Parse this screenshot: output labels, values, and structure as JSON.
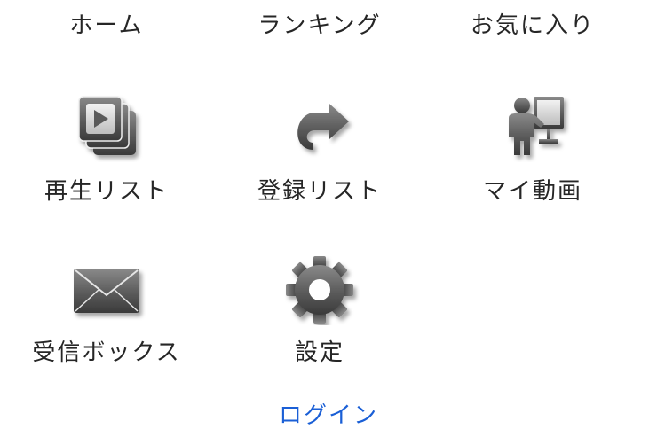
{
  "menu": {
    "row1": [
      {
        "label": "ホーム"
      },
      {
        "label": "ランキング"
      },
      {
        "label": "お気に入り"
      }
    ],
    "row2": [
      {
        "label": "再生リスト",
        "icon": "playlist-icon"
      },
      {
        "label": "登録リスト",
        "icon": "share-arrow-icon"
      },
      {
        "label": "マイ動画",
        "icon": "presenter-icon"
      }
    ],
    "row3": [
      {
        "label": "受信ボックス",
        "icon": "envelope-icon"
      },
      {
        "label": "設定",
        "icon": "gear-icon"
      }
    ]
  },
  "login": {
    "label": "ログイン"
  }
}
